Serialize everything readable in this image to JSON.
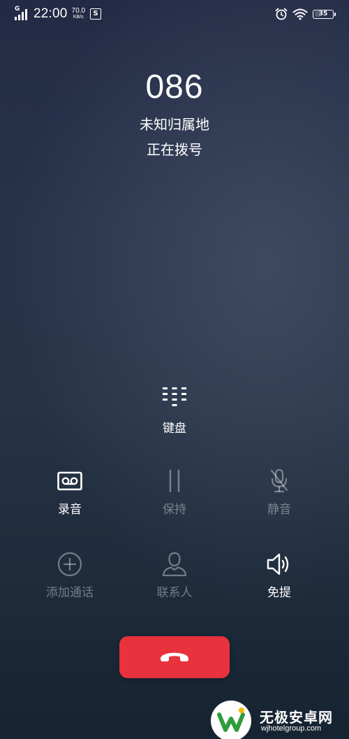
{
  "status_bar": {
    "network_type": "G",
    "time": "22:00",
    "net_speed_value": "70.0",
    "net_speed_unit": "KB/s",
    "sim_badge": "S",
    "battery_level": 35,
    "battery_label": "35",
    "icons": [
      "signal-icon",
      "alarm-icon",
      "wifi-icon",
      "battery-icon"
    ]
  },
  "call": {
    "number": "086",
    "location": "未知归属地",
    "status": "正在拨号"
  },
  "keypad": {
    "label": "键盘",
    "icon": "keypad-icon"
  },
  "actions": [
    {
      "label": "录音",
      "icon": "record-icon",
      "enabled": true
    },
    {
      "label": "保持",
      "icon": "hold-icon",
      "enabled": false
    },
    {
      "label": "静音",
      "icon": "mute-icon",
      "enabled": false
    },
    {
      "label": "添加通话",
      "icon": "add-call-icon",
      "enabled": false
    },
    {
      "label": "联系人",
      "icon": "contacts-icon",
      "enabled": false
    },
    {
      "label": "免提",
      "icon": "speaker-icon",
      "enabled": true
    }
  ],
  "end_call": {
    "icon": "end-call-icon",
    "color": "#e8323d"
  },
  "watermark": {
    "title": "无极安卓网",
    "url": "wjhotelgroup.com"
  }
}
